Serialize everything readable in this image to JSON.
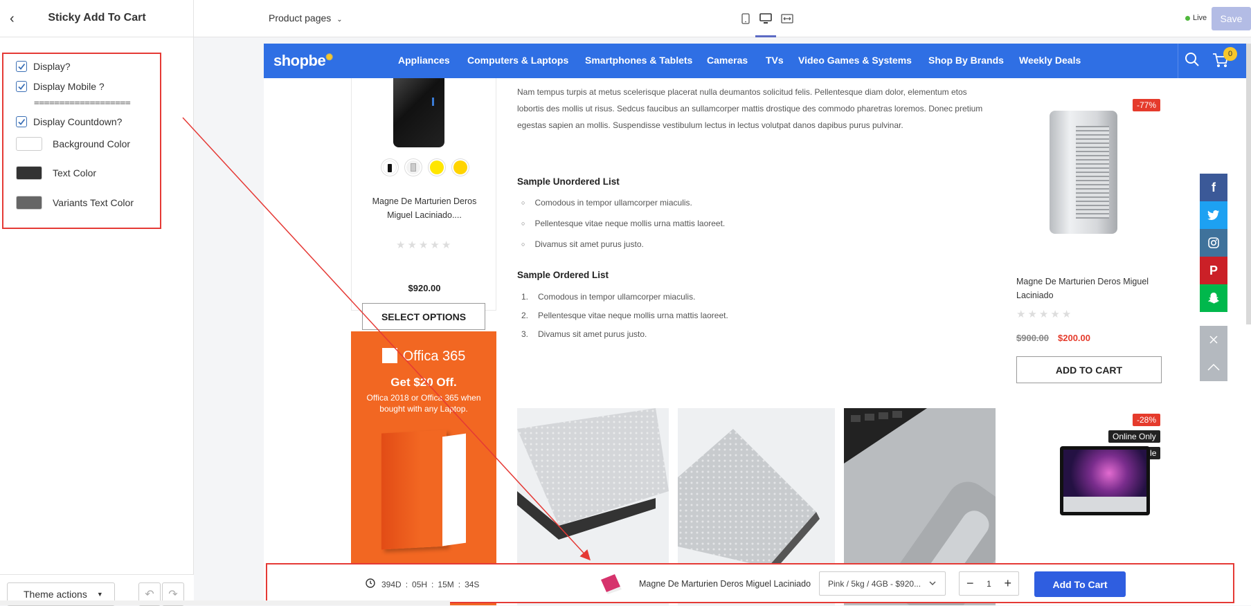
{
  "sidebar": {
    "title": "Sticky Add To Cart",
    "options": [
      {
        "label": "Display?",
        "checked": true
      },
      {
        "label": "Display Mobile ?",
        "checked": true
      },
      {
        "label": "Display Countdown?",
        "checked": true
      }
    ],
    "separator": "===================",
    "colors": [
      {
        "label": "Background Color",
        "value": "#ffffff"
      },
      {
        "label": "Text Color",
        "value": "#333333"
      },
      {
        "label": "Variants Text Color",
        "value": "#666666"
      }
    ],
    "theme_actions": "Theme actions"
  },
  "topbar": {
    "pages_label": "Product pages",
    "live_label": "Live",
    "save_label": "Save"
  },
  "store": {
    "logo": "shopbe",
    "nav": [
      "Appliances",
      "Computers & Laptops",
      "Smartphones & Tablets",
      "Cameras",
      "TVs",
      "Video Games & Systems",
      "Shop By Brands",
      "Weekly Deals"
    ],
    "cart_count": "0"
  },
  "left_product": {
    "name_line1": "Magne De Marturien Deros",
    "name_line2": "Miguel Laciniado....",
    "price": "$920.00",
    "button": "SELECT OPTIONS",
    "swatches": [
      "#111111",
      "#cccccc",
      "#ffe600",
      "#ffd400"
    ]
  },
  "banner": {
    "brand": "Offica 365",
    "headline": "Get $20 Off.",
    "sub": "Offica 2018 or Offica 365 when bought with any Laptop."
  },
  "content": {
    "paragraph": "Nam tempus turpis at metus scelerisque placerat nulla deumantos solicitud felis. Pellentesque diam dolor, elementum etos lobortis des mollis ut risus. Sedcus faucibus an sullamcorper mattis drostique des commodo pharetras loremos. Donec pretium egestas sapien an mollis. Suspendisse vestibulum lectus in lectus volutpat danos dapibus purus pulvinar.",
    "ul_title": "Sample Unordered List",
    "ul_items": [
      "Comodous in tempor ullamcorper miaculis.",
      "Pellentesque vitae neque mollis urna mattis laoreet.",
      "Divamus sit amet purus justo."
    ],
    "ol_title": "Sample Ordered List",
    "ol_items": [
      "Comodous in tempor ullamcorper miaculis.",
      "Pellentesque vitae neque mollis urna mattis laoreet.",
      "Divamus sit amet purus justo."
    ]
  },
  "right_product": {
    "discount": "-77%",
    "name": "Magne De Marturien Deros Miguel Laciniado",
    "old_price": "$900.00",
    "new_price": "$200.00",
    "button": "ADD TO CART"
  },
  "right_product2": {
    "discount": "-28%",
    "tag1": "Online Only",
    "tag2": "Bundle"
  },
  "social": [
    {
      "name": "facebook",
      "glyph": "f",
      "color": "#3b5998"
    },
    {
      "name": "twitter",
      "glyph": "t",
      "color": "#1da1f2"
    },
    {
      "name": "instagram",
      "glyph": "◎",
      "color": "#3f729b"
    },
    {
      "name": "pinterest",
      "glyph": "P",
      "color": "#cb2027"
    },
    {
      "name": "snapchat",
      "glyph": "☺",
      "color": "#00b84c"
    }
  ],
  "sticky": {
    "d": "394D",
    "h": "05H",
    "m": "15M",
    "s": "34S",
    "colon": ":",
    "product_name": "Magne De Marturien Deros Miguel Laciniado",
    "variant": "Pink / 5kg / 4GB - $920...",
    "qty": "1",
    "button": "Add To Cart"
  }
}
